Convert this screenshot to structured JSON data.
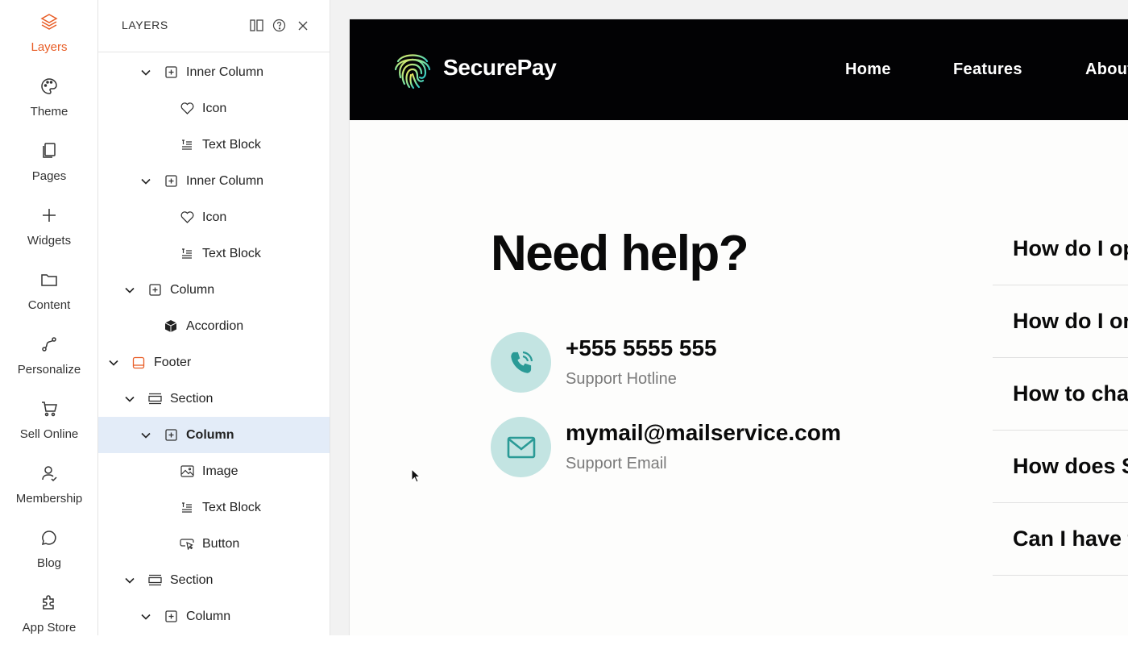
{
  "rail": {
    "items": [
      {
        "label": "Layers",
        "icon": "layers-icon",
        "active": true
      },
      {
        "label": "Theme",
        "icon": "palette-icon"
      },
      {
        "label": "Pages",
        "icon": "pages-icon"
      },
      {
        "label": "Widgets",
        "icon": "plus-icon"
      },
      {
        "label": "Content",
        "icon": "folder-icon"
      },
      {
        "label": "Personalize",
        "icon": "personalize-icon"
      },
      {
        "label": "Sell Online",
        "icon": "cart-icon"
      },
      {
        "label": "Membership",
        "icon": "member-icon"
      },
      {
        "label": "Blog",
        "icon": "chat-bubble-icon"
      },
      {
        "label": "App Store",
        "icon": "puzzle-icon"
      }
    ],
    "accent": "#e85d26"
  },
  "layers": {
    "title": "LAYERS",
    "rows": [
      {
        "label": "Inner Column",
        "icon": "column-icon",
        "expanded": true
      },
      {
        "label": "Icon",
        "icon": "heart-icon"
      },
      {
        "label": "Text Block",
        "icon": "text-block-icon"
      },
      {
        "label": "Inner Column",
        "icon": "column-icon",
        "expanded": true
      },
      {
        "label": "Icon",
        "icon": "heart-icon"
      },
      {
        "label": "Text Block",
        "icon": "text-block-icon"
      },
      {
        "label": "Column",
        "icon": "column-icon",
        "expanded": true
      },
      {
        "label": "Accordion",
        "icon": "cube-icon"
      },
      {
        "label": "Footer",
        "icon": "footer-icon",
        "expanded": true
      },
      {
        "label": "Section",
        "icon": "section-icon",
        "expanded": true
      },
      {
        "label": "Column",
        "icon": "column-icon",
        "expanded": true,
        "selected": true
      },
      {
        "label": "Image",
        "icon": "image-icon"
      },
      {
        "label": "Text Block",
        "icon": "text-block-icon"
      },
      {
        "label": "Button",
        "icon": "button-icon"
      },
      {
        "label": "Section",
        "icon": "section-icon",
        "expanded": true
      },
      {
        "label": "Column",
        "icon": "column-icon",
        "expanded": true
      }
    ]
  },
  "site": {
    "brand": "SecurePay",
    "nav": [
      "Home",
      "Features",
      "About"
    ],
    "help_title": "Need help?",
    "phone": "+555 5555 555",
    "phone_label": "Support Hotline",
    "email": "mymail@mailservice.com",
    "email_label": "Support Email",
    "faq": [
      "How do I op",
      "How do I or",
      "How to cha",
      "How does S",
      "Can I have t"
    ],
    "accent": "#2a9a96",
    "circle_bg": "#c3e4e2"
  }
}
